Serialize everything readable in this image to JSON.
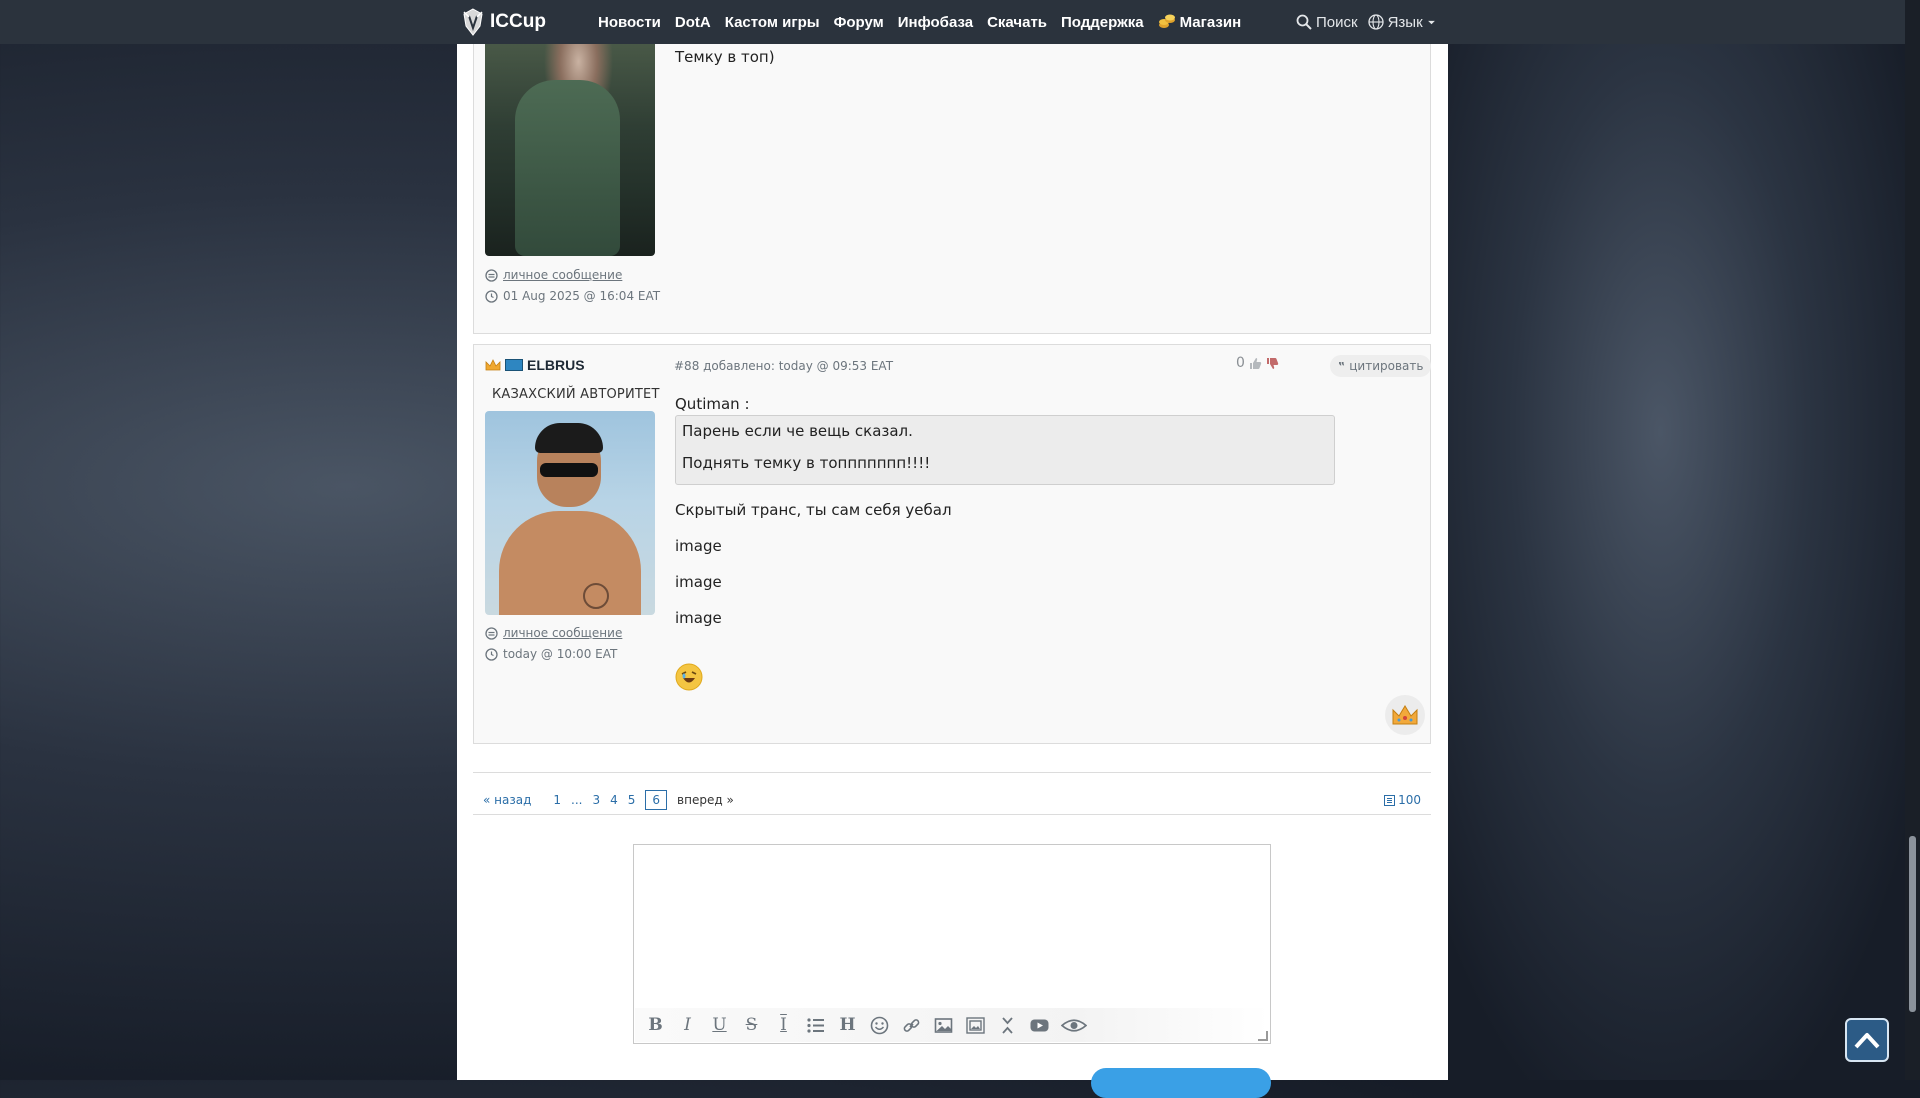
{
  "header": {
    "logo_text": "ICCup",
    "nav": [
      "Новости",
      "DotA",
      "Кастом игры",
      "Форум",
      "Инфобаза",
      "Скачать",
      "Поддержка"
    ],
    "shop_label": "Магазин",
    "search_label": "Поиск",
    "language_label": "Язык"
  },
  "post1": {
    "body": "Темку в топ)",
    "pm_label": "личное сообщение",
    "time": "01 Aug 2025 @ 16:04 EAT"
  },
  "post2": {
    "username": "ELBRUS",
    "user_title": "КАЗАХСКИЙ АВТОРИТЕТ",
    "meta": "#88 добавлено: today @ 09:53 EAT",
    "rating": "0",
    "quote_label": "цитировать",
    "quote_author": "Qutiman :",
    "quote_lines": [
      "Парень если че вещь сказал.",
      "Поднять темку в топпппппп!!!!"
    ],
    "body": "Скрытый транс, ты сам себя уебал",
    "image_alts": [
      "image",
      "image",
      "image"
    ],
    "pm_label": "личное сообщение",
    "time": "today @ 10:00 EAT"
  },
  "pagination": {
    "prev": "« назад",
    "pages": [
      "1",
      "...",
      "3",
      "4",
      "5"
    ],
    "current": "6",
    "next": "вперед »",
    "count": "100"
  },
  "colors": {
    "accent": "#2b6ea8",
    "submit": "#3aa0e6",
    "topbar": "#2b333d"
  }
}
